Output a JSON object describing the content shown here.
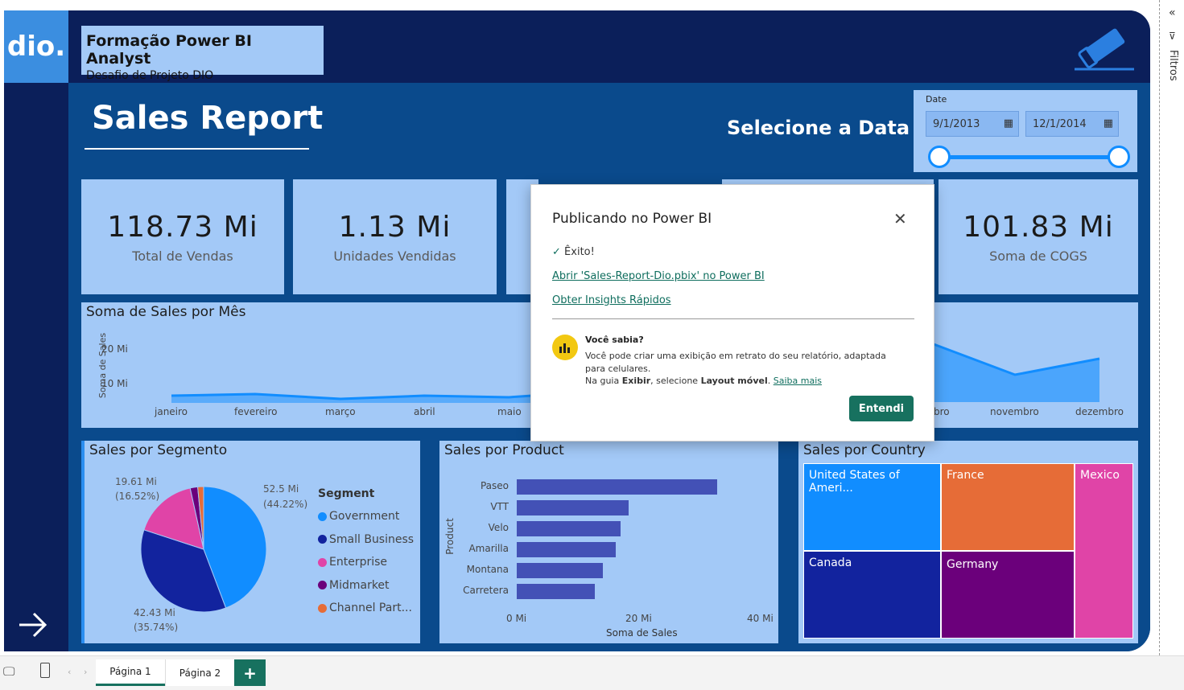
{
  "header": {
    "title": "Formação Power BI Analyst",
    "subtitle": "Desafio de Projeto DIO",
    "logo_text": "dio."
  },
  "report": {
    "title": "Sales Report",
    "date_prompt": "Selecione a Data",
    "date_slicer": {
      "label": "Date",
      "start": "9/1/2013",
      "end": "12/1/2014"
    }
  },
  "kpis": [
    {
      "value": "118.73 Mi",
      "label": "Total de Vendas"
    },
    {
      "value": "1.13 Mi",
      "label": "Unidades Vendidas"
    },
    {
      "value": "101.83 Mi",
      "label": "Soma de COGS"
    }
  ],
  "line_chart": {
    "title": "Soma de Sales por Mês",
    "ylabel": "Soma de Sales",
    "yticks": [
      "20 Mi",
      "10 Mi"
    ],
    "xticks_left": [
      "janeiro",
      "fevereiro",
      "março",
      "abril",
      "maio"
    ],
    "xticks_right": [
      "bro",
      "novembro",
      "dezembro"
    ]
  },
  "chart_data": [
    {
      "type": "pie",
      "title": "Sales por Segmento",
      "legend_title": "Segment",
      "categories": [
        "Government",
        "Small Business",
        "Enterprise",
        "Midmarket",
        "Channel Part..."
      ],
      "colors": [
        "#118dff",
        "#12239e",
        "#e044a7",
        "#6b007b",
        "#e66c37"
      ],
      "values": [
        52.5,
        42.43,
        19.61,
        2.3,
        1.8
      ],
      "labels": [
        {
          "value": "52.5 Mi",
          "pct": "(44.22%)"
        },
        {
          "value": "42.43 Mi",
          "pct": "(35.74%)"
        },
        {
          "value": "19.61 Mi",
          "pct": "(16.52%)"
        }
      ]
    },
    {
      "type": "bar",
      "title": "Sales por Product",
      "xlabel": "Soma de Sales",
      "ylabel": "Product",
      "categories": [
        "Paseo",
        "VTT",
        "Velo",
        "Amarilla",
        "Montana",
        "Carretera"
      ],
      "values": [
        33,
        18.4,
        17.1,
        16.3,
        14.2,
        12.9
      ],
      "xlim": [
        0,
        40
      ],
      "xticks": [
        "0 Mi",
        "20 Mi",
        "40 Mi"
      ],
      "color": "#4351b6"
    },
    {
      "type": "treemap",
      "title": "Sales por Country",
      "categories": [
        "United States of Ameri...",
        "France",
        "Mexico",
        "Canada",
        "Germany"
      ],
      "colors": [
        "#118dff",
        "#e66c37",
        "#e044a7",
        "#12239e",
        "#6b007b"
      ]
    }
  ],
  "dialog": {
    "title": "Publicando no Power BI",
    "success": "Êxito!",
    "link_open": "Abrir 'Sales-Report-Dio.pbix' no Power BI",
    "link_insights": "Obter Insights Rápidos",
    "tip_title": "Você sabia?",
    "tip_text1": "Você pode criar uma exibição em retrato do seu relatório, adaptada para celulares.",
    "tip_text2_a": "Na guia ",
    "tip_text2_b": "Exibir",
    "tip_text2_c": ", selecione ",
    "tip_text2_d": "Layout móvel",
    "tip_text2_e": ". ",
    "tip_link": "Saiba mais",
    "button": "Entendi"
  },
  "filters_pane": {
    "label": "Filtros"
  },
  "pages": {
    "tab1": "Página 1",
    "tab2": "Página 2",
    "add": "+"
  }
}
